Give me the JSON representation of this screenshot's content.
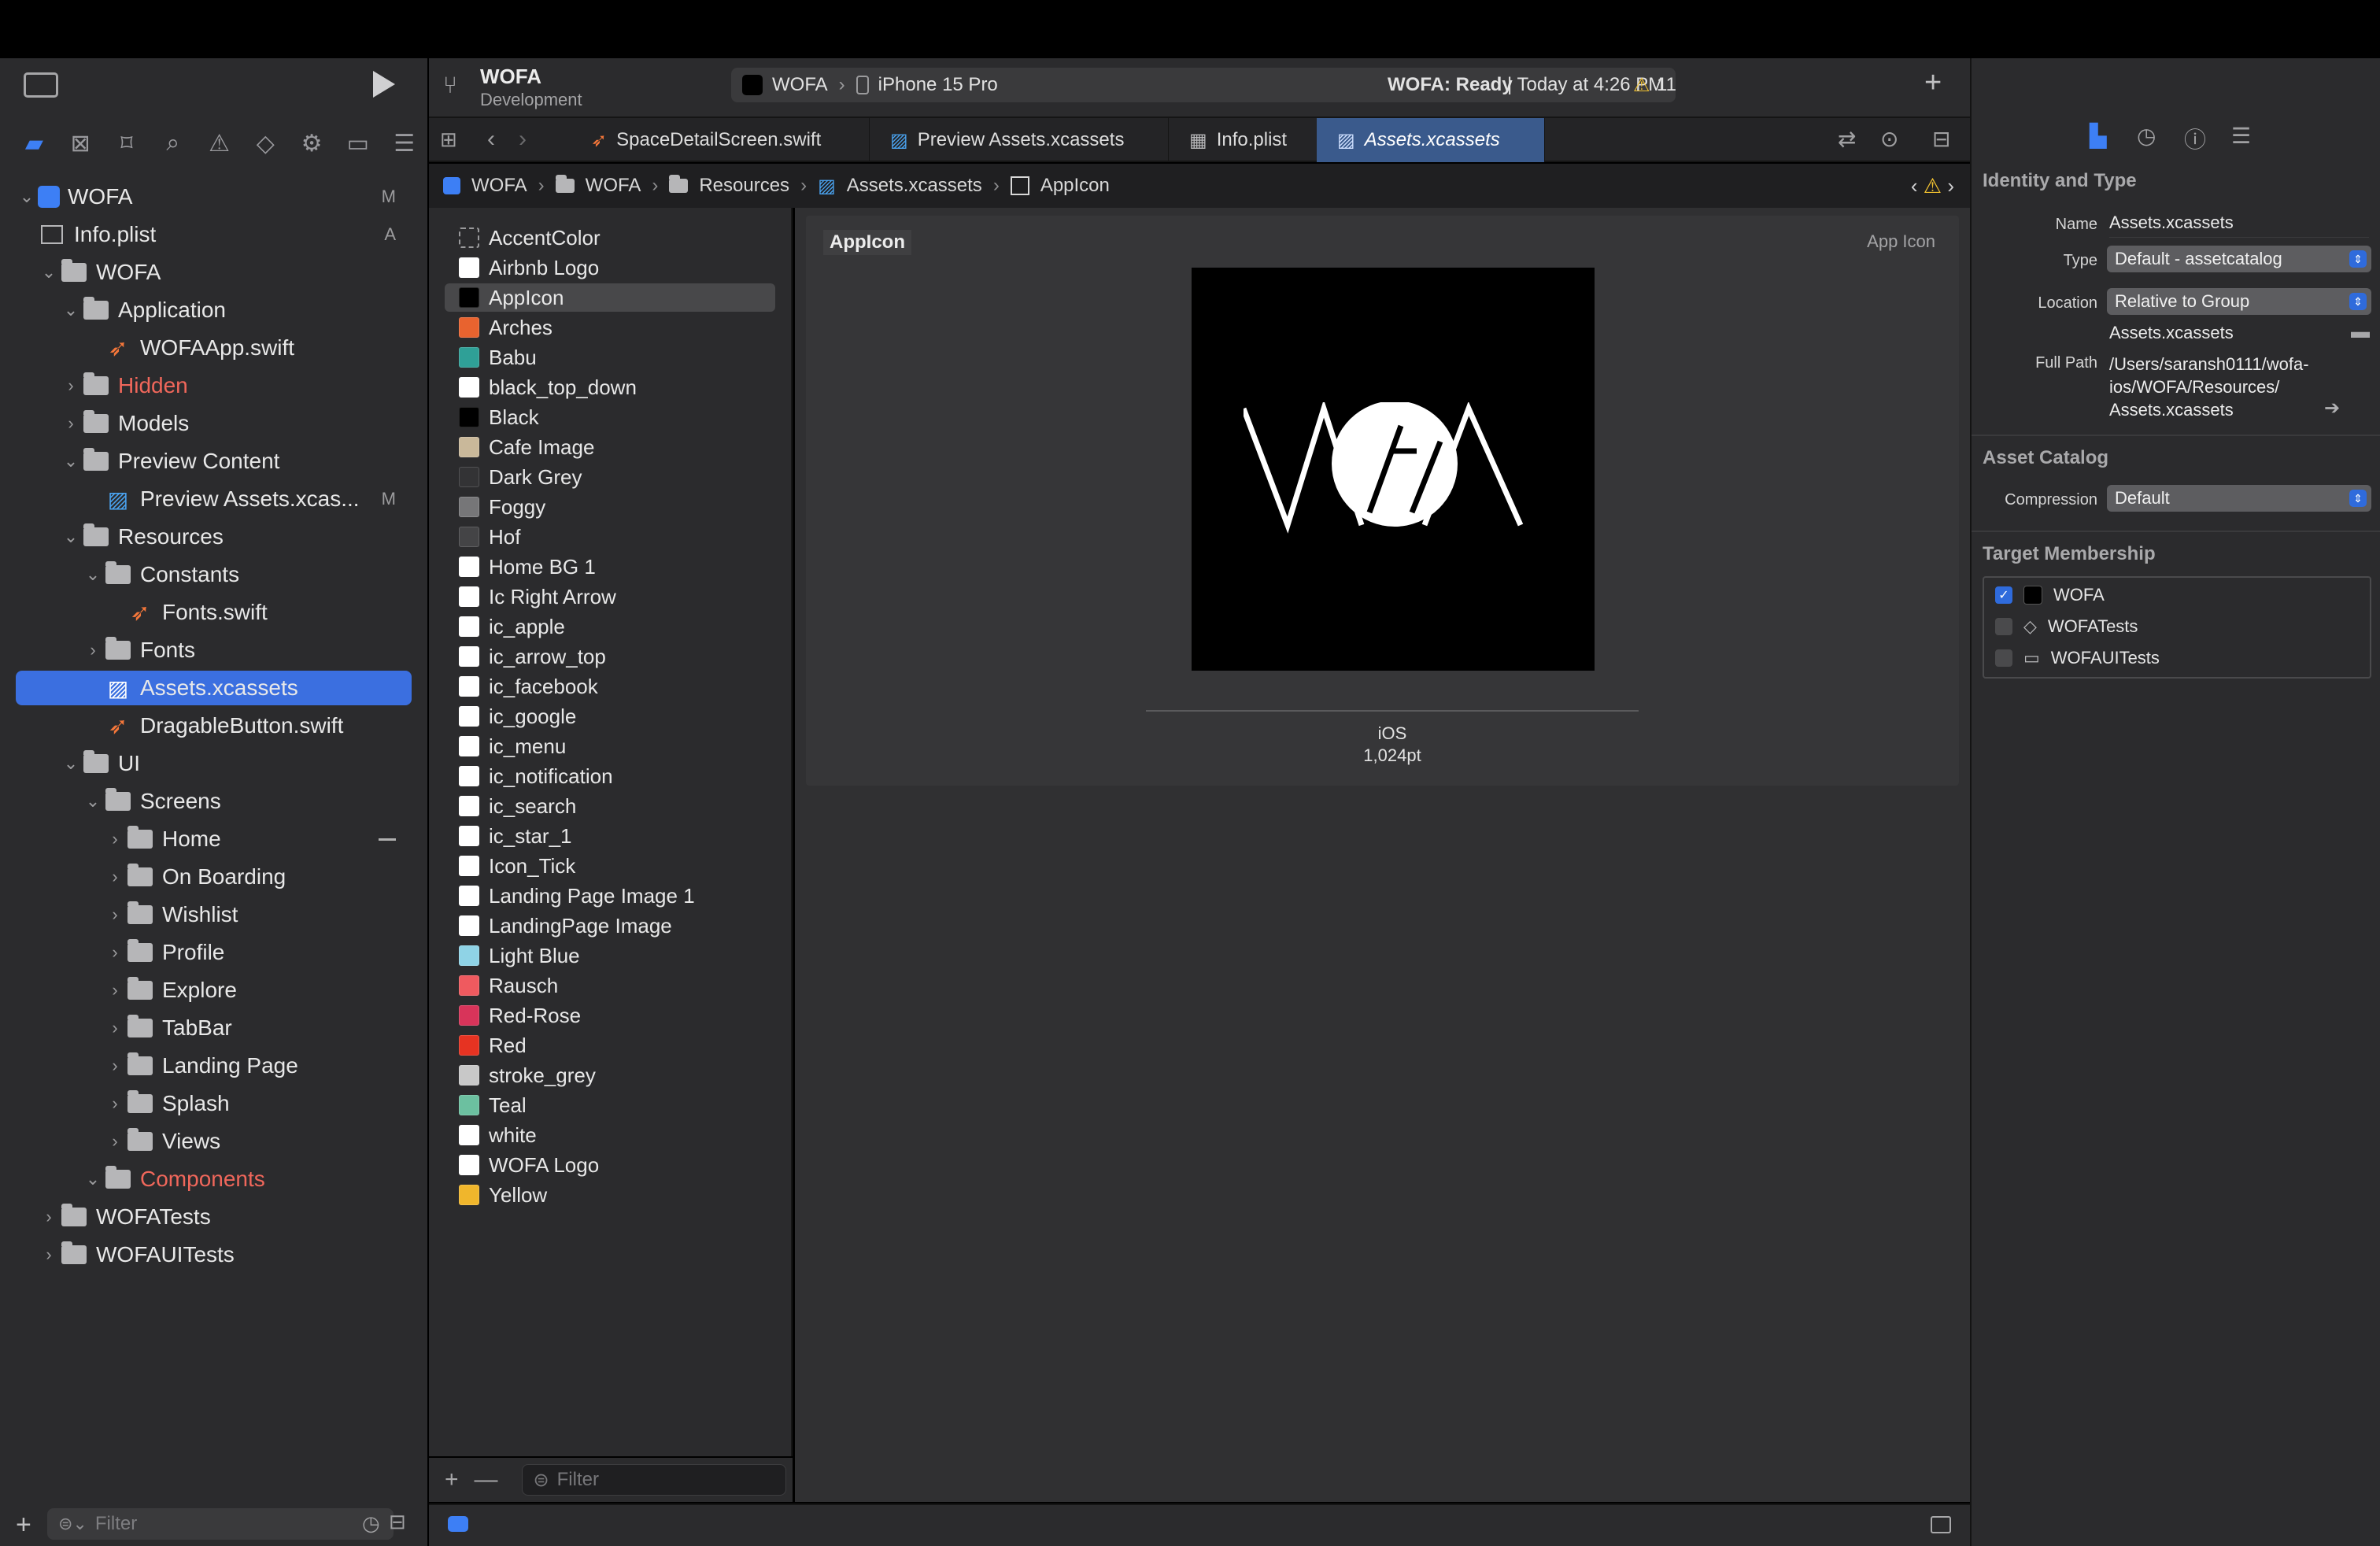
{
  "project": {
    "name": "WOFA",
    "subtitle": "Development"
  },
  "scheme": {
    "target": "WOFA",
    "device": "iPhone 15 Pro",
    "status_bold": "WOFA: Ready",
    "status_rest": " | Today at 4:26 PM",
    "warnings": "11"
  },
  "tabs": [
    "SpaceDetailScreen.swift",
    "Preview Assets.xcassets",
    "Info.plist",
    "Assets.xcassets"
  ],
  "breadcrumb": [
    "WOFA",
    "WOFA",
    "Resources",
    "Assets.xcassets",
    "AppIcon"
  ],
  "navigator": {
    "filter_placeholder": "Filter",
    "tree": [
      {
        "label": "WOFA",
        "badge": "M"
      },
      {
        "label": "Info.plist",
        "badge": "A"
      },
      {
        "label": "WOFA"
      },
      {
        "label": "Application"
      },
      {
        "label": "WOFAApp.swift"
      },
      {
        "label": "Hidden"
      },
      {
        "label": "Models"
      },
      {
        "label": "Preview Content"
      },
      {
        "label": "Preview Assets.xcas...",
        "badge": "M"
      },
      {
        "label": "Resources"
      },
      {
        "label": "Constants"
      },
      {
        "label": "Fonts.swift"
      },
      {
        "label": "Fonts"
      },
      {
        "label": "Assets.xcassets"
      },
      {
        "label": "DragableButton.swift"
      },
      {
        "label": "UI"
      },
      {
        "label": "Screens"
      },
      {
        "label": "Home"
      },
      {
        "label": "On Boarding"
      },
      {
        "label": "Wishlist"
      },
      {
        "label": "Profile"
      },
      {
        "label": "Explore"
      },
      {
        "label": "TabBar"
      },
      {
        "label": "Landing Page"
      },
      {
        "label": "Splash"
      },
      {
        "label": "Views"
      },
      {
        "label": "Components"
      },
      {
        "label": "WOFATests"
      },
      {
        "label": "WOFAUITests"
      }
    ]
  },
  "assets": {
    "filter_placeholder": "Filter",
    "items": [
      {
        "label": "AccentColor",
        "color": "transparent"
      },
      {
        "label": "Airbnb Logo",
        "color": "#ffffff"
      },
      {
        "label": "AppIcon",
        "color": "#000000"
      },
      {
        "label": "Arches",
        "color": "#e8632f"
      },
      {
        "label": "Babu",
        "color": "#2fa097"
      },
      {
        "label": "black_top_down",
        "color": "#ffffff"
      },
      {
        "label": "Black",
        "color": "#000000"
      },
      {
        "label": "Cafe Image",
        "color": "#c9b89a"
      },
      {
        "label": "Dark Grey",
        "color": "#333335"
      },
      {
        "label": "Foggy",
        "color": "#767678"
      },
      {
        "label": "Hof",
        "color": "#444446"
      },
      {
        "label": "Home BG 1",
        "color": "#ffffff"
      },
      {
        "label": "Ic Right Arrow",
        "color": "#ffffff"
      },
      {
        "label": "ic_apple",
        "color": "#ffffff"
      },
      {
        "label": "ic_arrow_top",
        "color": "#ffffff"
      },
      {
        "label": "ic_facebook",
        "color": "#ffffff"
      },
      {
        "label": "ic_google",
        "color": "#ffffff"
      },
      {
        "label": "ic_menu",
        "color": "#ffffff"
      },
      {
        "label": "ic_notification",
        "color": "#ffffff"
      },
      {
        "label": "ic_search",
        "color": "#ffffff"
      },
      {
        "label": "ic_star_1",
        "color": "#ffffff"
      },
      {
        "label": "Icon_Tick",
        "color": "#ffffff"
      },
      {
        "label": "Landing Page Image 1",
        "color": "#ffffff"
      },
      {
        "label": "LandingPage Image",
        "color": "#ffffff"
      },
      {
        "label": "Light Blue",
        "color": "#8fd3e6"
      },
      {
        "label": "Rausch",
        "color": "#ef5a5f"
      },
      {
        "label": "Red-Rose",
        "color": "#d8345a"
      },
      {
        "label": "Red",
        "color": "#e63322"
      },
      {
        "label": "stroke_grey",
        "color": "#c8c8c8"
      },
      {
        "label": "Teal",
        "color": "#6cc0a0"
      },
      {
        "label": "white",
        "color": "#ffffff"
      },
      {
        "label": "WOFA Logo",
        "color": "#ffffff"
      },
      {
        "label": "Yellow",
        "color": "#f0b62c"
      }
    ]
  },
  "canvas": {
    "title": "AppIcon",
    "kind": "App Icon",
    "platform": "iOS",
    "size": "1,024pt",
    "icon_text": "WOFA"
  },
  "inspector": {
    "identity_header": "Identity and Type",
    "name_label": "Name",
    "name_value": "Assets.xcassets",
    "type_label": "Type",
    "type_value": "Default - assetcatalog",
    "location_label": "Location",
    "location_value": "Relative to Group",
    "location_file": "Assets.xcassets",
    "fullpath_label": "Full Path",
    "fullpath_lines": [
      "/Users/saransh0111/wofa-",
      "ios/WOFA/Resources/",
      "Assets.xcassets"
    ],
    "catalog_header": "Asset Catalog",
    "compression_label": "Compression",
    "compression_value": "Default",
    "membership_header": "Target Membership",
    "members": [
      {
        "label": "WOFA",
        "checked": true
      },
      {
        "label": "WOFATests",
        "checked": false
      },
      {
        "label": "WOFAUITests",
        "checked": false
      }
    ]
  }
}
